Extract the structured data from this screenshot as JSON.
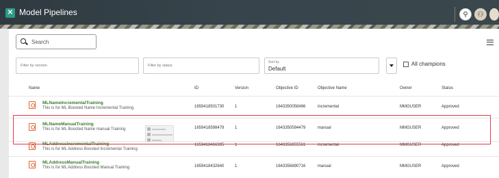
{
  "header": {
    "title": "Model Pipelines"
  },
  "search": {
    "placeholder": "Search"
  },
  "filters": {
    "version_placeholder": "Filter by version",
    "status_placeholder": "Filter by status"
  },
  "sort": {
    "label": "Sort by",
    "value": "Default"
  },
  "champions": {
    "label": "All champions"
  },
  "table": {
    "headers": {
      "name": "Name",
      "id": "ID",
      "version": "Version",
      "objective_id": "Objective ID",
      "objective_name": "Objective Name",
      "owner": "Owner",
      "status": "Status"
    },
    "rows": [
      {
        "name": "MLNameIncrementalTraining",
        "description": "This is for ML Boosted Name Incremental Training",
        "id": "1659418501730",
        "version": "1",
        "objective_id": "1643350058466",
        "objective_name": "incremental",
        "owner": "MMGUSER",
        "status": "Approved"
      },
      {
        "name": "MLNameManualTraining",
        "description": "This is for ML Boosted Name manual Training",
        "id": "1659418598479",
        "version": "1",
        "objective_id": "1643350594479",
        "objective_name": "manual",
        "owner": "MMGUSER",
        "status": "Approved"
      },
      {
        "name": "MLAddressIncrementalTraining",
        "description": "This is for ML Address Boosted Incremental Training",
        "id": "1659418466395",
        "version": "1",
        "objective_id": "1643356855561",
        "objective_name": "incremental",
        "owner": "MMGUSER",
        "status": "Approved"
      },
      {
        "name": "MLAddressManualTraining",
        "description": "This is for ML Address Boosted Manual Training",
        "id": "1659418432640",
        "version": "1",
        "objective_id": "1643356890716",
        "objective_name": "manual",
        "owner": "MMGUSER",
        "status": "Approved"
      }
    ]
  },
  "colors": {
    "accent_green": "#3b7a2e",
    "icon_orange": "#e0612c",
    "highlight_red": "#e03a47"
  }
}
